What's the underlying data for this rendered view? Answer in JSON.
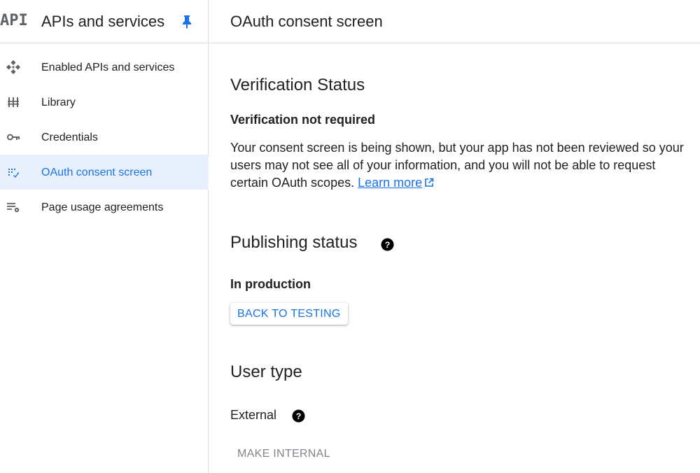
{
  "sidebar": {
    "logo_text": "API",
    "title": "APIs and services",
    "items": [
      {
        "label": "Enabled APIs and services",
        "icon": "diamond-dots-icon"
      },
      {
        "label": "Library",
        "icon": "library-icon"
      },
      {
        "label": "Credentials",
        "icon": "key-icon"
      },
      {
        "label": "OAuth consent screen",
        "icon": "consent-screen-icon",
        "active": true
      },
      {
        "label": "Page usage agreements",
        "icon": "list-settings-icon"
      }
    ]
  },
  "main": {
    "page_title": "OAuth consent screen",
    "verification": {
      "heading": "Verification Status",
      "status": "Verification not required",
      "description": "Your consent screen is being shown, but your app has not been reviewed so your users may not see all of your information, and you will not be able to request certain OAuth scopes.",
      "link_label": "Learn more"
    },
    "publishing": {
      "heading": "Publishing status",
      "status": "In production",
      "button_label": "BACK TO TESTING"
    },
    "user_type": {
      "heading": "User type",
      "value": "External",
      "button_label": "MAKE INTERNAL"
    }
  },
  "colors": {
    "accent": "#1a73e8",
    "active_bg": "#e8f0fe",
    "border": "#dadce0",
    "disabled_text": "#80868b",
    "icon_gray": "#5f6368"
  }
}
